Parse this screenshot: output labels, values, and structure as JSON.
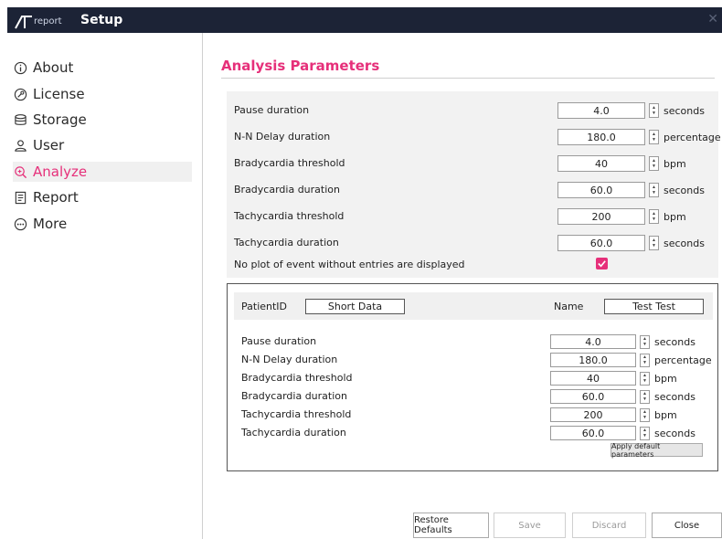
{
  "window": {
    "logo_small": "report",
    "title": "Setup",
    "close_glyph": "✕"
  },
  "sidebar": {
    "items": [
      {
        "label": "About",
        "icon": "info-icon"
      },
      {
        "label": "License",
        "icon": "key-icon"
      },
      {
        "label": "Storage",
        "icon": "database-icon"
      },
      {
        "label": "User",
        "icon": "user-icon"
      },
      {
        "label": "Analyze",
        "icon": "analyze-icon",
        "active": true
      },
      {
        "label": "Report",
        "icon": "report-icon"
      },
      {
        "label": "More",
        "icon": "more-icon"
      }
    ]
  },
  "main": {
    "heading": "Analysis Parameters",
    "params": [
      {
        "label": "Pause duration",
        "value": "4.0",
        "unit": "seconds"
      },
      {
        "label": "N-N Delay duration",
        "value": "180.0",
        "unit": "percentage"
      },
      {
        "label": "Bradycardia threshold",
        "value": "40",
        "unit": "bpm"
      },
      {
        "label": "Bradycardia duration",
        "value": "60.0",
        "unit": "seconds"
      },
      {
        "label": "Tachycardia threshold",
        "value": "200",
        "unit": "bpm"
      },
      {
        "label": "Tachycardia duration",
        "value": "60.0",
        "unit": "seconds"
      }
    ],
    "no_plot_label": "No plot of event without entries are displayed",
    "no_plot_checked": true
  },
  "patient": {
    "id_label": "PatientID",
    "id_value": "Short Data",
    "name_label": "Name",
    "name_value": "Test Test",
    "params": [
      {
        "label": "Pause duration",
        "value": "4.0",
        "unit": "seconds"
      },
      {
        "label": "N-N Delay duration",
        "value": "180.0",
        "unit": "percentage"
      },
      {
        "label": "Bradycardia threshold",
        "value": "40",
        "unit": "bpm"
      },
      {
        "label": "Bradycardia duration",
        "value": "60.0",
        "unit": "seconds"
      },
      {
        "label": "Tachycardia threshold",
        "value": "200",
        "unit": "bpm"
      },
      {
        "label": "Tachycardia duration",
        "value": "60.0",
        "unit": "seconds"
      }
    ],
    "apply_label": "Apply default parameters"
  },
  "footer": {
    "restore": "Restore Defaults",
    "save": "Save",
    "discard": "Discard",
    "close": "Close"
  },
  "colors": {
    "accent": "#e6307a",
    "titlebar": "#1c2336"
  }
}
